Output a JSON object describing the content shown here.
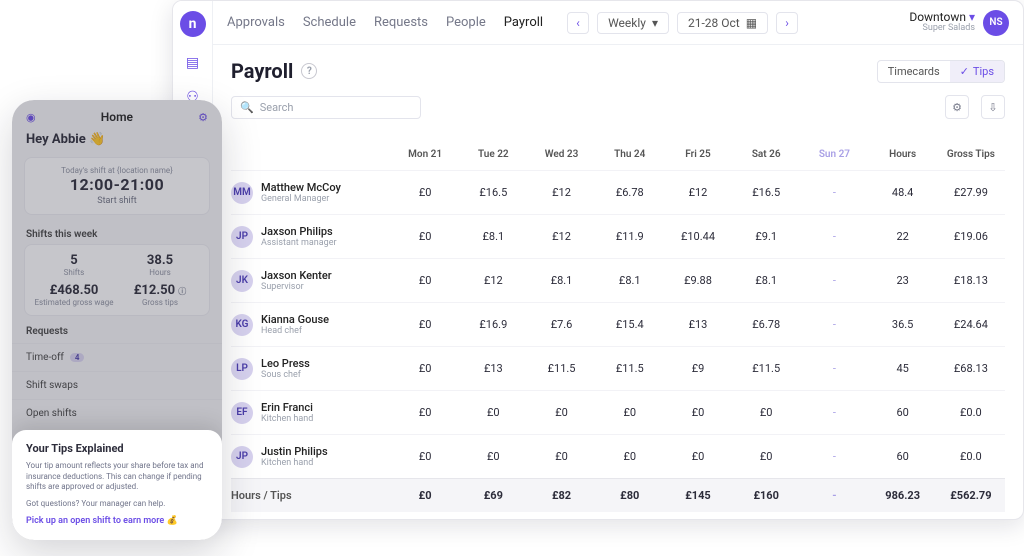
{
  "top_nav": {
    "items": [
      "Approvals",
      "Schedule",
      "Requests",
      "People",
      "Payroll"
    ],
    "active_index": 4,
    "period_mode": "Weekly",
    "period_range": "21-28 Oct"
  },
  "location": {
    "name": "Downtown",
    "sub": "Super Salads",
    "user_initials": "NS"
  },
  "page": {
    "title": "Payroll",
    "toggle": {
      "left": "Timecards",
      "right": "Tips",
      "active": "right"
    },
    "search_placeholder": "Search"
  },
  "columns": [
    "Mon 21",
    "Tue 22",
    "Wed 23",
    "Thu 24",
    "Fri 25",
    "Sat 26",
    "Sun 27",
    "Hours",
    "Gross Tips"
  ],
  "employees": [
    {
      "name": "Matthew McCoy",
      "role": "General Manager",
      "cells": [
        "£0",
        "£16.5",
        "£12",
        "£6.78",
        "£12",
        "£16.5",
        "-",
        "48.4",
        "£27.99"
      ]
    },
    {
      "name": "Jaxson Philips",
      "role": "Assistant manager",
      "cells": [
        "£0",
        "£8.1",
        "£12",
        "£11.9",
        "£10.44",
        "£9.1",
        "-",
        "22",
        "£19.06"
      ]
    },
    {
      "name": "Jaxson Kenter",
      "role": "Supervisor",
      "cells": [
        "£0",
        "£12",
        "£8.1",
        "£8.1",
        "£9.88",
        "£8.1",
        "-",
        "23",
        "£18.13"
      ]
    },
    {
      "name": "Kianna Gouse",
      "role": "Head chef",
      "cells": [
        "£0",
        "£16.9",
        "£7.6",
        "£15.4",
        "£13",
        "£6.78",
        "-",
        "36.5",
        "£24.64"
      ]
    },
    {
      "name": "Leo Press",
      "role": "Sous chef",
      "cells": [
        "£0",
        "£13",
        "£11.5",
        "£11.5",
        "£9",
        "£11.5",
        "-",
        "45",
        "£68.13"
      ]
    },
    {
      "name": "Erin Franci",
      "role": "Kitchen hand",
      "cells": [
        "£0",
        "£0",
        "£0",
        "£0",
        "£0",
        "£0",
        "-",
        "60",
        "£0.0"
      ]
    },
    {
      "name": "Justin Philips",
      "role": "Kitchen hand",
      "cells": [
        "£0",
        "£0",
        "£0",
        "£0",
        "£0",
        "£0",
        "-",
        "60",
        "£0.0"
      ]
    }
  ],
  "totals": {
    "label": "Hours / Tips",
    "cells": [
      "£0",
      "£69",
      "£82",
      "£80",
      "£145",
      "£160",
      "-",
      "986.23",
      "£562.79"
    ]
  },
  "mobile": {
    "header": "Home",
    "greeting": "Hey Abbie 👋",
    "shift_card": {
      "subtitle": "Today's shift at {location name}",
      "time": "12:00-21:00",
      "action": "Start shift"
    },
    "shifts_label": "Shifts this week",
    "stats": [
      {
        "value": "5",
        "label": "Shifts"
      },
      {
        "value": "38.5",
        "label": "Hours"
      },
      {
        "value": "£468.50",
        "label": "Estimated gross wage"
      },
      {
        "value": "£12.50",
        "label": "Gross tips"
      }
    ],
    "requests_label": "Requests",
    "requests": [
      {
        "label": "Time-off",
        "badge": "4"
      },
      {
        "label": "Shift swaps"
      },
      {
        "label": "Open shifts"
      }
    ],
    "sheet": {
      "title": "Your Tips Explained",
      "body1": "Your tip amount reflects your share before tax and insurance deductions. This can change if pending shifts are approved or adjusted.",
      "body2": "Got questions? Your manager can help.",
      "cta": "Pick up an open shift to earn more 💰"
    }
  }
}
